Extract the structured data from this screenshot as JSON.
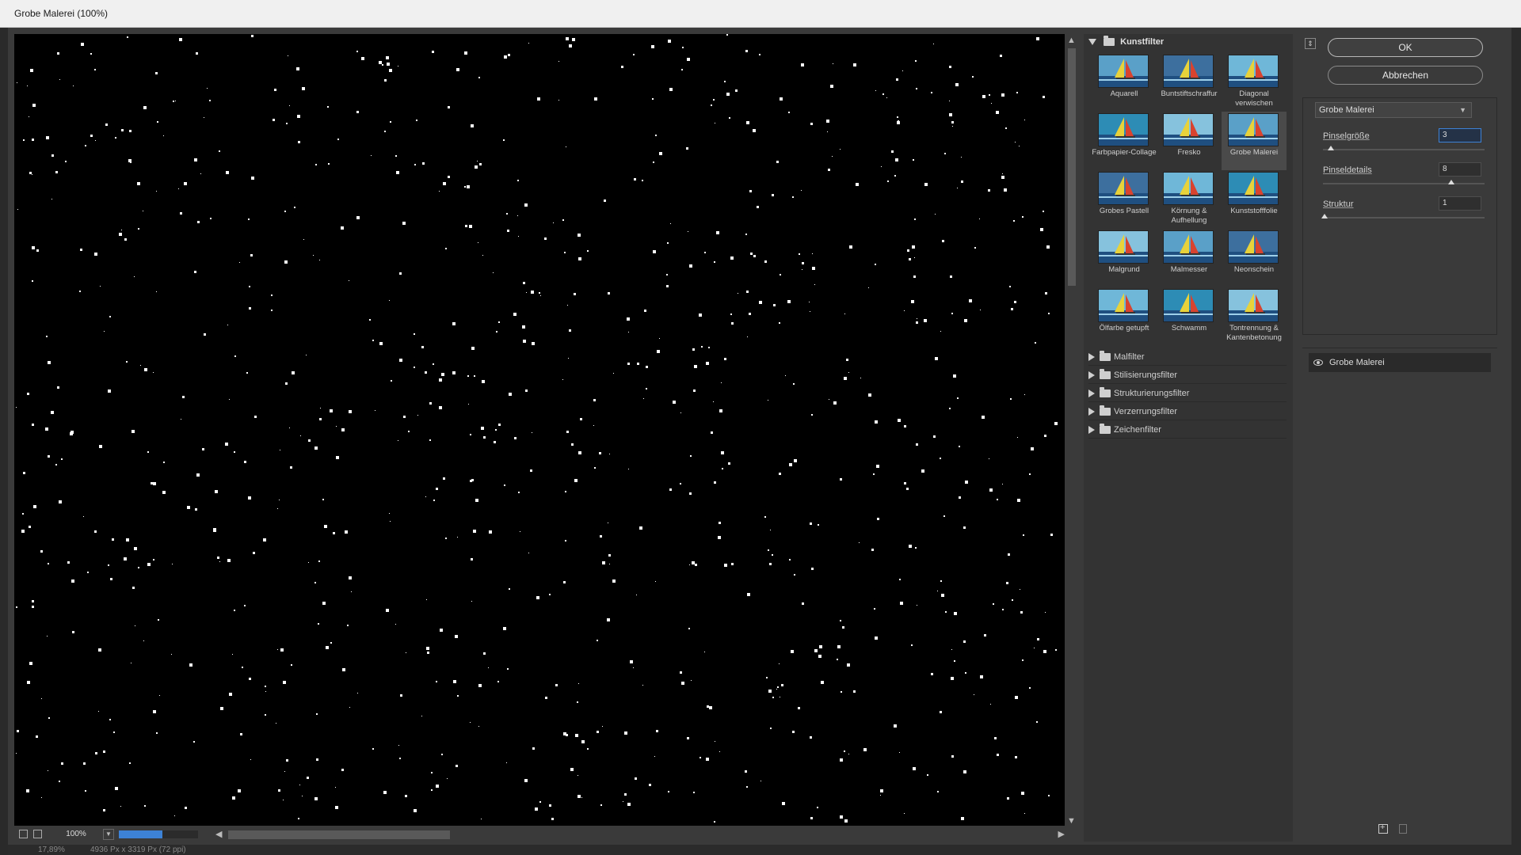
{
  "window": {
    "title": "Grobe Malerei (100%)"
  },
  "preview": {
    "zoom": "100%",
    "render_progress": 0.55
  },
  "status": {
    "zoom": "17,89%",
    "doc_info": "4936 Px x 3319 Px (72 ppi)"
  },
  "gallery": {
    "open_category": "Kunstfilter",
    "thumbnails": [
      {
        "label": "Aquarell",
        "selected": false
      },
      {
        "label": "Buntstiftschraffur",
        "selected": false
      },
      {
        "label": "Diagonal verwischen",
        "selected": false
      },
      {
        "label": "Farbpapier-Collage",
        "selected": false
      },
      {
        "label": "Fresko",
        "selected": false
      },
      {
        "label": "Grobe Malerei",
        "selected": true
      },
      {
        "label": "Grobes Pastell",
        "selected": false
      },
      {
        "label": "Körnung & Aufhellung",
        "selected": false
      },
      {
        "label": "Kunststofffolie",
        "selected": false
      },
      {
        "label": "Malgrund",
        "selected": false
      },
      {
        "label": "Malmesser",
        "selected": false
      },
      {
        "label": "Neonschein",
        "selected": false
      },
      {
        "label": "Ölfarbe getupft",
        "selected": false
      },
      {
        "label": "Schwamm",
        "selected": false
      },
      {
        "label": "Tontrennung & Kantenbetonung",
        "selected": false
      }
    ],
    "categories": [
      "Malfilter",
      "Stilisierungsfilter",
      "Strukturierungsfilter",
      "Verzerrungsfilter",
      "Zeichenfilter"
    ]
  },
  "settings": {
    "ok_label": "OK",
    "cancel_label": "Abbrechen",
    "filter_select": "Grobe Malerei",
    "params": [
      {
        "label": "Pinselgröße",
        "value": "3",
        "active": true,
        "min": 1,
        "max": 50
      },
      {
        "label": "Pinseldetails",
        "value": "8",
        "active": false,
        "min": 0,
        "max": 10
      },
      {
        "label": "Struktur",
        "value": "1",
        "active": false,
        "min": 1,
        "max": 10
      }
    ],
    "layer_name": "Grobe Malerei"
  },
  "colors": {
    "accent": "#3d82d6",
    "panel_bg": "#3a3a3a",
    "preview_bg": "#000000"
  }
}
